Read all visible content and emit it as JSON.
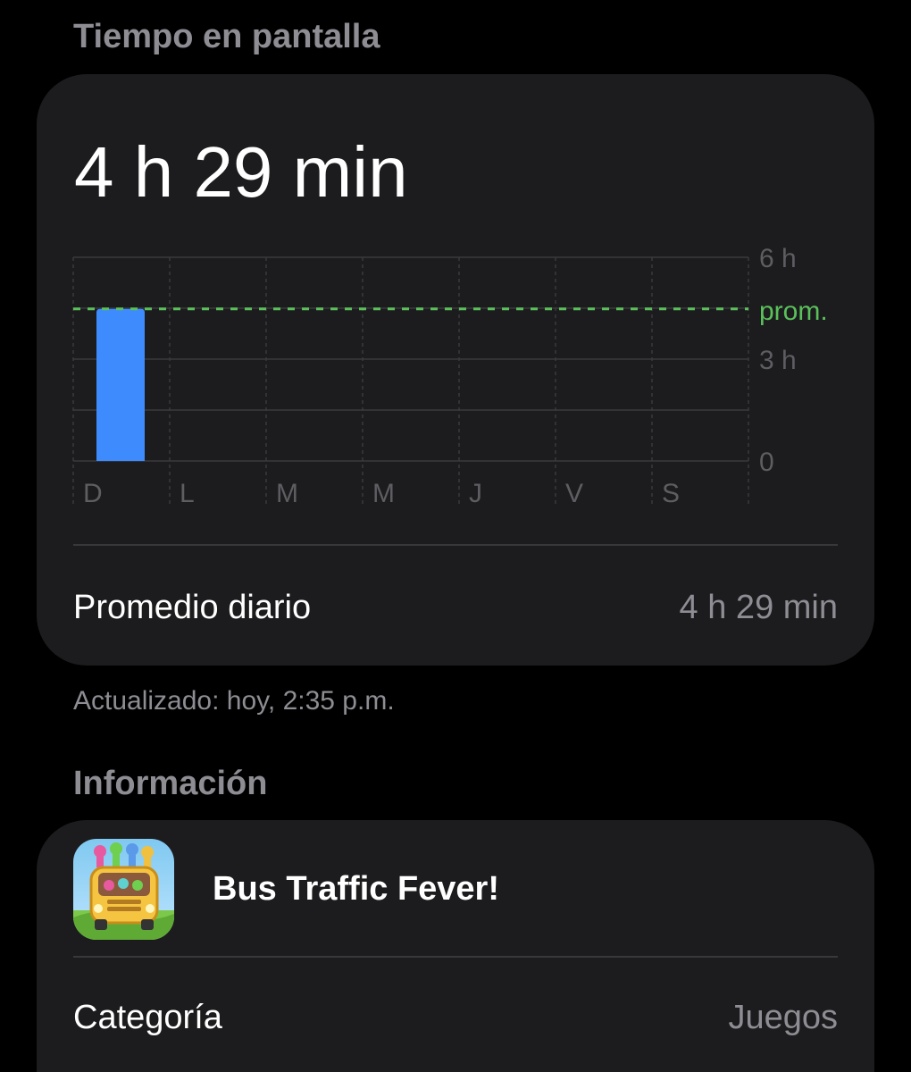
{
  "screen_time_header": "Tiempo en pantalla",
  "total_time": "4 h 29 min",
  "chart_data": {
    "type": "bar",
    "categories": [
      "D",
      "L",
      "M",
      "M",
      "J",
      "V",
      "S"
    ],
    "values": [
      4.48,
      0,
      0,
      0,
      0,
      0,
      0
    ],
    "average": 4.48,
    "average_label": "prom.",
    "y_tick_labels": [
      "6 h",
      "3 h",
      "0"
    ],
    "y_ticks": [
      6,
      3,
      0
    ],
    "ylim": [
      0,
      6
    ],
    "colors": {
      "bar": "#3d8bfd",
      "average_line": "#5ac05a",
      "grid": "#3a3a3c",
      "label": "#5d5d62"
    }
  },
  "daily_average": {
    "label": "Promedio diario",
    "value": "4 h 29 min"
  },
  "updated_text": "Actualizado: hoy, 2:35 p.m.",
  "info_header": "Información",
  "app": {
    "name": "Bus Traffic Fever!",
    "icon": "bus-game-icon"
  },
  "category": {
    "label": "Categoría",
    "value": "Juegos"
  }
}
